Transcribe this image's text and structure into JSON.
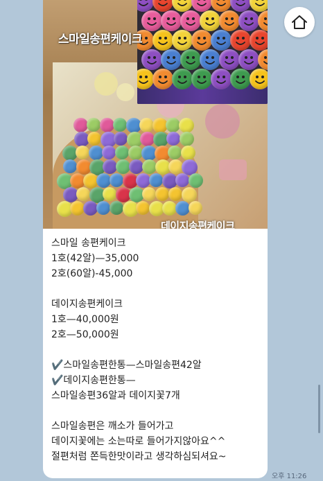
{
  "message": {
    "photo": {
      "caption_top": "스마일송편케이크",
      "caption_bottom": "데이지송편케이크"
    },
    "lines": [
      "스마일 송편케이크",
      "1호(42알)—35,000",
      "2호(60알)-45,000",
      "",
      "데이지송편케이크",
      "1호—40,000원",
      "2호—50,000원",
      "",
      "✔️스마일송편한통—스마일송편42알",
      "✔️데이지송편한통—",
      "스마일송편36알과 데이지꽃7개",
      "",
      "스마일송편은 깨소가 들어가고",
      "데이지꽃에는 소는따로 들어가지않아요^^",
      "절편처럼 쫀득한맛이라고 생각하심되셔요~"
    ],
    "timestamp": "오후 11:26"
  },
  "icons": {
    "home": "home-icon"
  },
  "colors": {
    "chat_background": "#b2c7d9",
    "bubble": "#ffffff"
  }
}
